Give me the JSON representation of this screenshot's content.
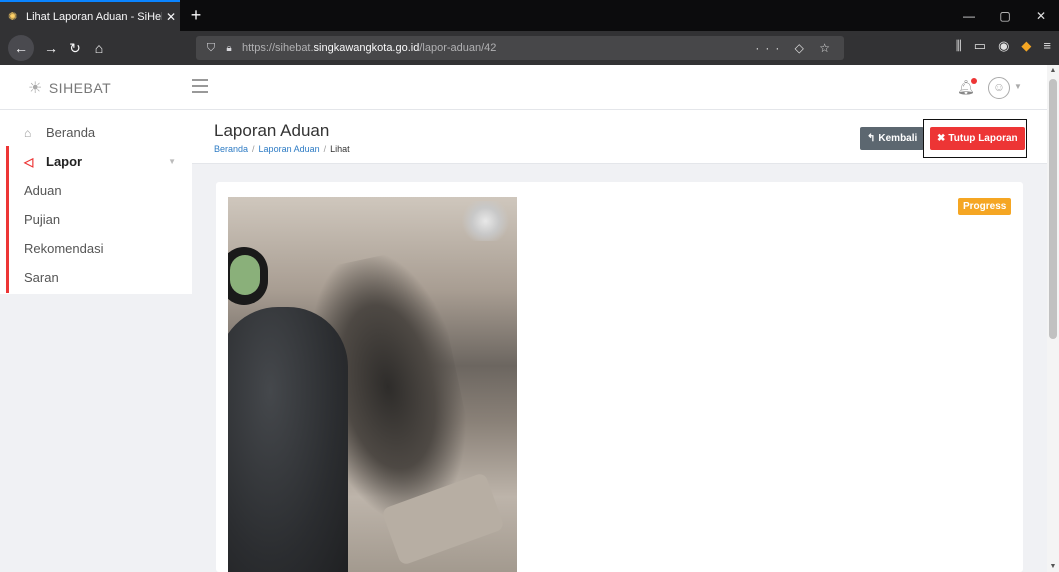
{
  "browser": {
    "tab_title": "Lihat Laporan Aduan - SiHebat",
    "tab_close": "✕",
    "new_tab": "+",
    "url_prefix": "https://sihebat.",
    "url_host": "singkawangkota.go.id",
    "url_path": "/lapor-aduan/42",
    "url_actions": "··· ◇ ☆"
  },
  "app": {
    "brand": "SIHEBAT"
  },
  "sidebar": {
    "items": [
      {
        "label": "Beranda",
        "icon": "home-icon"
      },
      {
        "label": "Lapor",
        "icon": "megaphone-icon"
      }
    ],
    "subitems": [
      "Aduan",
      "Pujian",
      "Rekomendasi",
      "Saran"
    ]
  },
  "page": {
    "title": "Laporan Aduan",
    "breadcrumb": [
      "Beranda",
      "Laporan Aduan",
      "Lihat"
    ],
    "breadcrumb_sep": "/",
    "back_label": "Kembali",
    "close_label": "Tutup Laporan",
    "status_badge": "Progress"
  },
  "colors": {
    "accent_red": "#ed3535",
    "badge_orange": "#f5a623",
    "link_blue": "#2d7bc4"
  }
}
